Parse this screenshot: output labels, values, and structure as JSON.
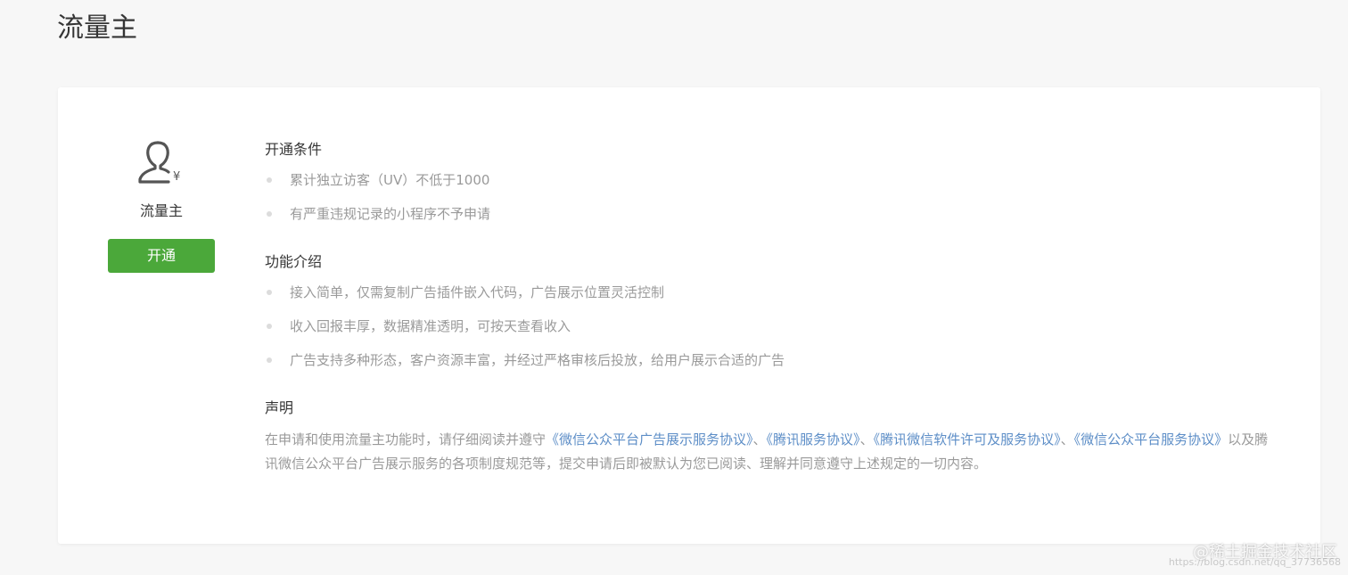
{
  "page": {
    "title": "流量主"
  },
  "side": {
    "label": "流量主",
    "open_button": "开通",
    "icon": "user-yuan-icon",
    "icon_symbol": "¥"
  },
  "sections": {
    "conditions": {
      "title": "开通条件",
      "items": [
        "累计独立访客（UV）不低于1000",
        "有严重违规记录的小程序不予申请"
      ]
    },
    "features": {
      "title": "功能介绍",
      "items": [
        "接入简单，仅需复制广告插件嵌入代码，广告展示位置灵活控制",
        "收入回报丰厚，数据精准透明，可按天查看收入",
        "广告支持多种形态，客户资源丰富，并经过严格审核后投放，给用户展示合适的广告"
      ]
    },
    "statement": {
      "title": "声明",
      "text_before": "在申请和使用流量主功能时，请仔细阅读并遵守",
      "links": [
        "《微信公众平台广告展示服务协议》",
        "《腾讯服务协议》",
        "《腾讯微信软件许可及服务协议》",
        "《微信公众平台服务协议》"
      ],
      "separator": "、",
      "text_after": "以及腾讯微信公众平台广告展示服务的各项制度规范等，提交申请后即被默认为您已阅读、理解并同意遵守上述规定的一切内容。"
    }
  },
  "watermark": {
    "text": "@稀土掘金技术社区",
    "sub": "https://blog.csdn.net/qq_37736568"
  },
  "colors": {
    "accent_green": "#4ba83a",
    "link_blue": "#5d8ec7",
    "muted_text": "#9a9a9a"
  }
}
